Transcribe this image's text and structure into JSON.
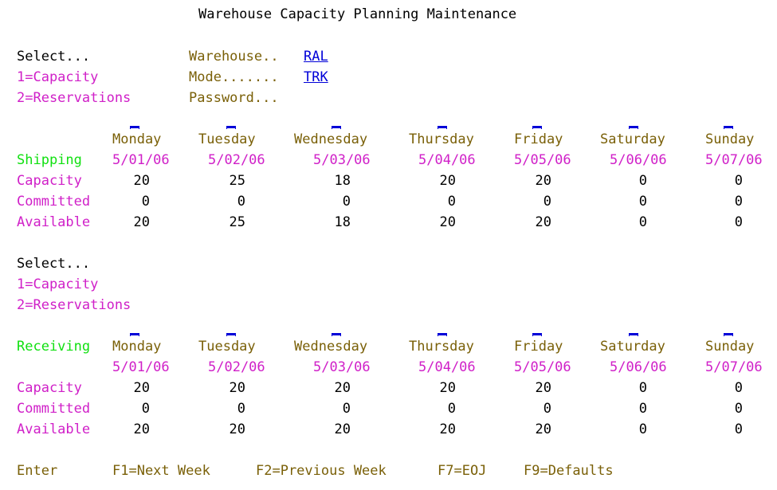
{
  "title": "Warehouse Capacity Planning Maintenance",
  "header": {
    "select_label": "Select...",
    "option1": "1=Capacity",
    "option2": "2=Reservations",
    "warehouse_label": "Warehouse..",
    "warehouse_value": "RAL",
    "mode_label": "Mode.......",
    "mode_value": "TRK",
    "password_label": "Password..."
  },
  "days": [
    "Monday",
    "Tuesday",
    "Wednesday",
    "Thursday",
    "Friday",
    "Saturday",
    "Sunday"
  ],
  "dates": [
    "5/01/06",
    "5/02/06",
    "5/03/06",
    "5/04/06",
    "5/05/06",
    "5/06/06",
    "5/07/06"
  ],
  "row_labels": {
    "capacity": "Capacity",
    "committed": "Committed",
    "available": "Available"
  },
  "shipping": {
    "label": "Shipping",
    "capacity": [
      "20",
      "25",
      "18",
      "20",
      "20",
      "0",
      "0"
    ],
    "committed": [
      "0",
      "0",
      "0",
      "0",
      "0",
      "0",
      "0"
    ],
    "available": [
      "20",
      "25",
      "18",
      "20",
      "20",
      "0",
      "0"
    ]
  },
  "middle": {
    "select_label": "Select...",
    "option1": "1=Capacity",
    "option2": "2=Reservations"
  },
  "receiving": {
    "label": "Receiving",
    "capacity": [
      "20",
      "20",
      "20",
      "20",
      "20",
      "0",
      "0"
    ],
    "committed": [
      "0",
      "0",
      "0",
      "0",
      "0",
      "0",
      "0"
    ],
    "available": [
      "20",
      "20",
      "20",
      "20",
      "20",
      "0",
      "0"
    ]
  },
  "footer": {
    "enter": "Enter",
    "f1": "F1=Next Week",
    "f2": "F2=Previous Week",
    "f7": "F7=EOJ",
    "f9": "F9=Defaults"
  }
}
